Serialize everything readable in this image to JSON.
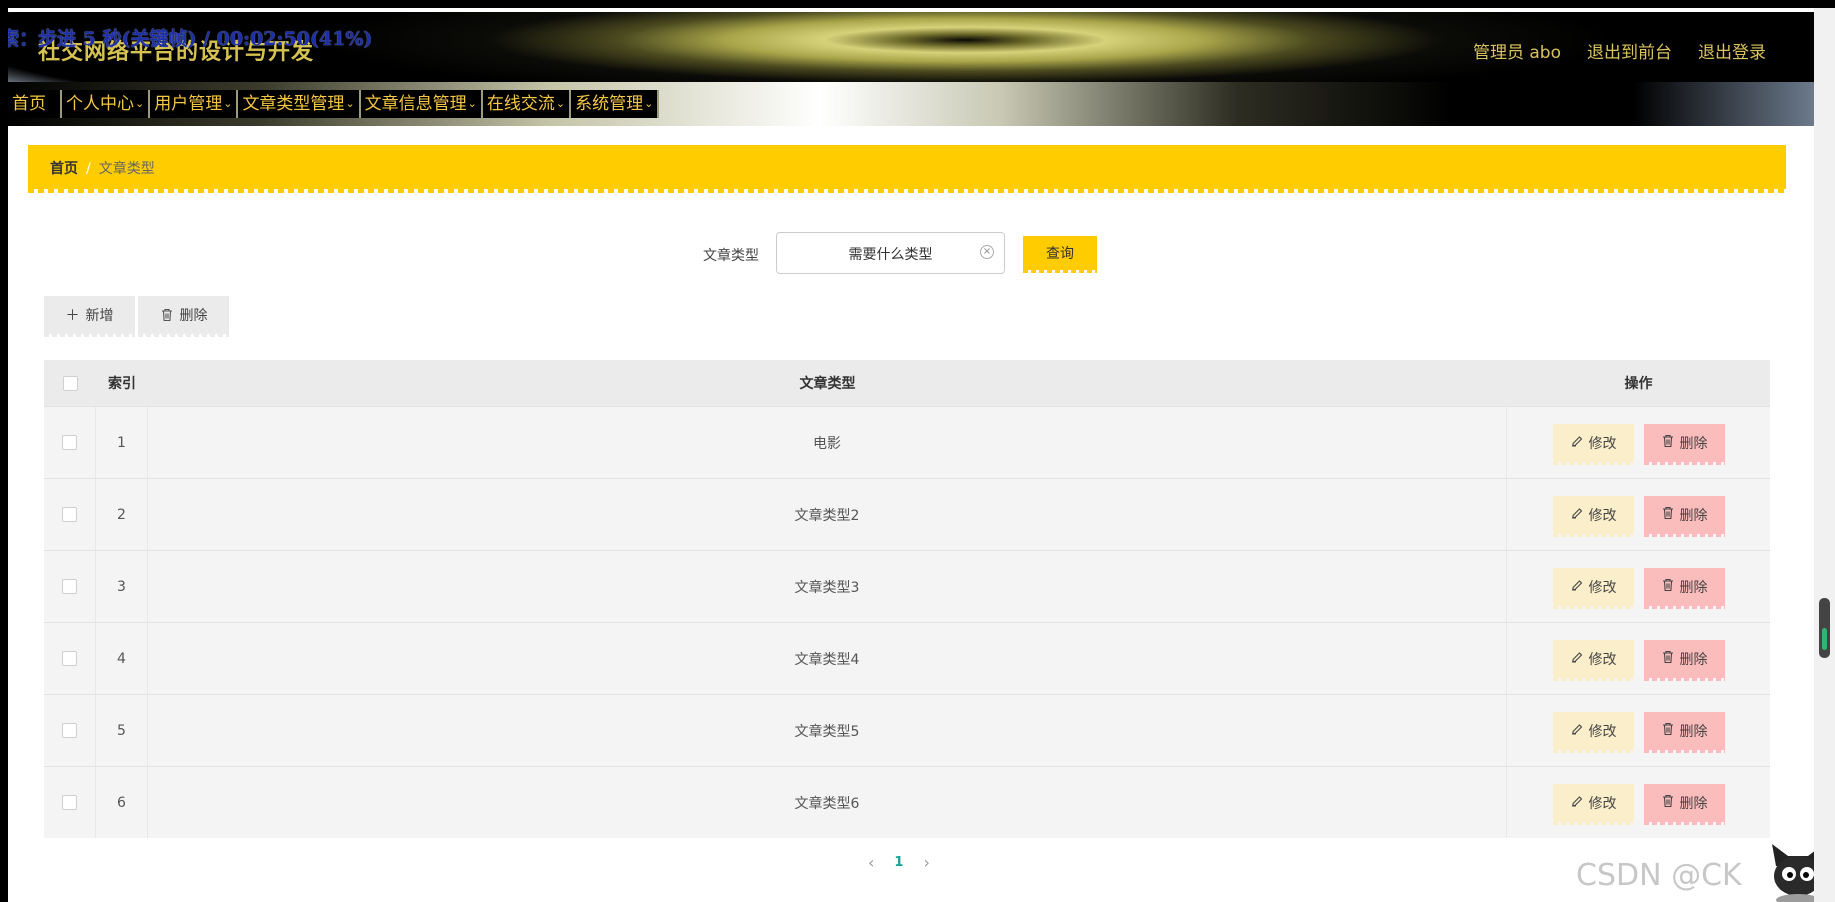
{
  "header": {
    "site_title": "社交网络平台的设计与开发",
    "overlay_text": "索：步进 5 秒(关键帧) / 00:02:50(41%)",
    "user_label": "管理员 abo",
    "to_front_label": "退出到前台",
    "logout_label": "退出登录"
  },
  "nav": {
    "items": [
      {
        "label": "首页",
        "has_dropdown": false
      },
      {
        "label": "个人中心",
        "has_dropdown": true
      },
      {
        "label": "用户管理",
        "has_dropdown": true
      },
      {
        "label": "文章类型管理",
        "has_dropdown": true
      },
      {
        "label": "文章信息管理",
        "has_dropdown": true
      },
      {
        "label": "在线交流",
        "has_dropdown": true
      },
      {
        "label": "系统管理",
        "has_dropdown": true
      }
    ]
  },
  "breadcrumb": {
    "home": "首页",
    "separator": "/",
    "current": "文章类型"
  },
  "search": {
    "label": "文章类型",
    "value": "需要什么类型",
    "button_label": "查询"
  },
  "toolbar": {
    "add_label": "新增",
    "delete_label": "删除"
  },
  "table": {
    "headers": {
      "index": "索引",
      "type": "文章类型",
      "actions": "操作"
    },
    "rows": [
      {
        "index": "1",
        "type": "电影"
      },
      {
        "index": "2",
        "type": "文章类型2"
      },
      {
        "index": "3",
        "type": "文章类型3"
      },
      {
        "index": "4",
        "type": "文章类型4"
      },
      {
        "index": "5",
        "type": "文章类型5"
      },
      {
        "index": "6",
        "type": "文章类型6"
      }
    ],
    "edit_label": "修改",
    "delete_label": "删除"
  },
  "pagination": {
    "current_page": "1"
  },
  "watermark": "CSDN @CK",
  "colors": {
    "accent": "#ffcc00",
    "nav_text": "#f6c743",
    "edit_bg": "#fbefcb",
    "delete_bg": "#fbbcbc",
    "page_active": "#17a398"
  }
}
